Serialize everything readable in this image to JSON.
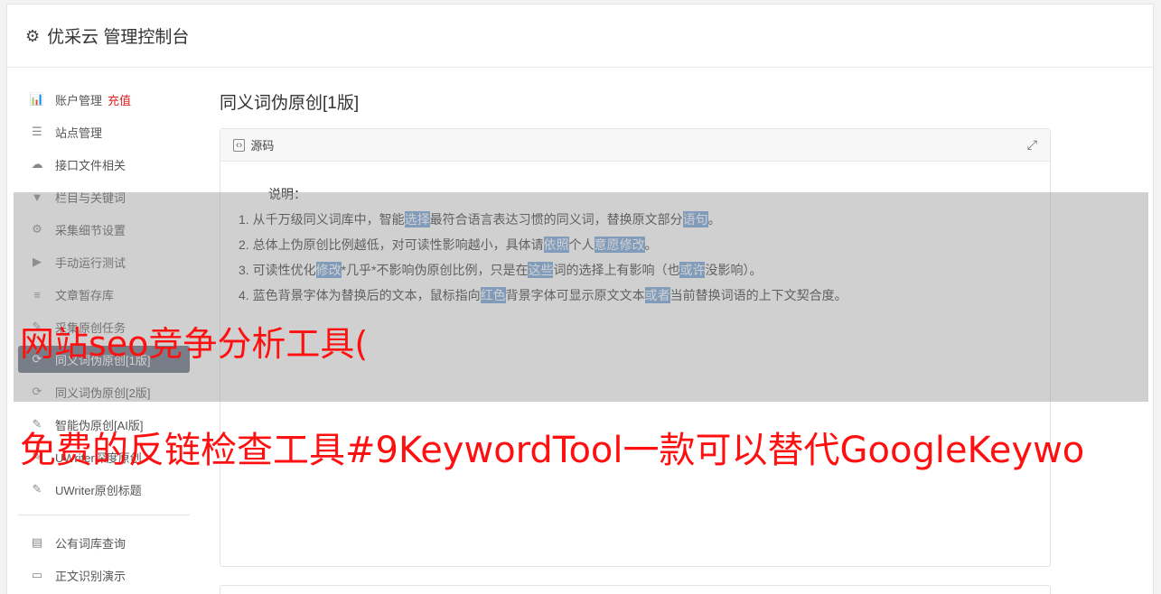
{
  "header": {
    "title": "优采云 管理控制台"
  },
  "sidebar": {
    "items": [
      {
        "label": "账户管理",
        "icon": "bar-chart-icon",
        "badge": "充值"
      },
      {
        "label": "站点管理",
        "icon": "server-icon"
      },
      {
        "label": "接口文件相关",
        "icon": "cloud-upload-icon"
      },
      {
        "label": "栏目与关键词",
        "icon": "filter-icon"
      },
      {
        "label": "采集细节设置",
        "icon": "gears-icon"
      },
      {
        "label": "手动运行测试",
        "icon": "play-circle-icon"
      },
      {
        "label": "文章暂存库",
        "icon": "database-icon"
      },
      {
        "label": "采集原创任务",
        "icon": "edit-icon"
      },
      {
        "label": "同义词伪原创[1版]",
        "icon": "refresh-icon",
        "active": true
      },
      {
        "label": "同义词伪原创[2版]",
        "icon": "refresh-icon"
      },
      {
        "label": "智能伪原创[AI版]",
        "icon": "edit-icon"
      },
      {
        "label": "UWriter深度原创",
        "icon": "edit-icon"
      },
      {
        "label": "UWriter原创标题",
        "icon": "edit-icon"
      }
    ],
    "items2": [
      {
        "label": "公有词库查询",
        "icon": "book-icon"
      },
      {
        "label": "正文识别演示",
        "icon": "window-icon"
      }
    ]
  },
  "main": {
    "page_title": "同义词伪原创[1版]",
    "panel_title": "源码",
    "note_title": "说明：",
    "notes": [
      [
        {
          "t": "1. 从千万级同义词库中，智能"
        },
        {
          "t": "选择",
          "hl": true
        },
        {
          "t": "最符合语言表达习惯的同义词，替换原文部分"
        },
        {
          "t": "语句",
          "hl": true
        },
        {
          "t": "。"
        }
      ],
      [
        {
          "t": "2. 总体上伪原创比例越低，对可读性影响越小，具体请"
        },
        {
          "t": "依照",
          "hl": true
        },
        {
          "t": "个人"
        },
        {
          "t": "意愿",
          "hl": true
        },
        {
          "t": "修改",
          "hl": true
        },
        {
          "t": "。"
        }
      ],
      [
        {
          "t": "3. 可读性优化"
        },
        {
          "t": "修改",
          "hl": true
        },
        {
          "t": "*几乎*不影响伪原创比例，只是在"
        },
        {
          "t": "这些",
          "hl": true
        },
        {
          "t": "词的选择上有影响（也"
        },
        {
          "t": "或许",
          "hl": true
        },
        {
          "t": "没影响）。"
        }
      ],
      [
        {
          "t": "4. 蓝色背景字体为替换后的文本，鼠标指向"
        },
        {
          "t": "红色",
          "hl": true
        },
        {
          "t": "背景字体可显示原文文本"
        },
        {
          "t": "或者",
          "hl": true
        },
        {
          "t": "当前替换词语的上下文契合度。"
        }
      ]
    ]
  },
  "overlay": {
    "line1": "网站seo竞争分析工具(",
    "line2": "免费的反链检查工具#9KeywordTool一款可以替代GoogleKeywo"
  },
  "colors": {
    "highlight": "#6f9fd8",
    "active_nav": "#5f6b7c",
    "recharge": "#e02020",
    "overlay_text": "#ff1010"
  }
}
